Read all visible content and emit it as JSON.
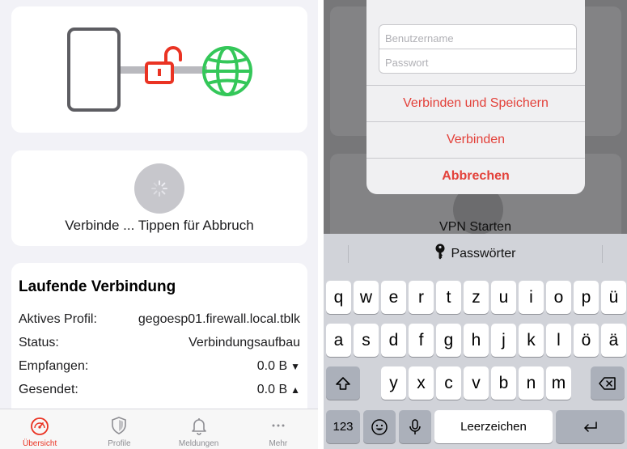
{
  "left": {
    "connect_status": "Verbinde ... Tippen für Abbruch",
    "running": {
      "title": "Laufende Verbindung",
      "rows": [
        {
          "label": "Aktives Profil:",
          "value": "gegoesp01.firewall.local.tblk",
          "arrow": ""
        },
        {
          "label": "Status:",
          "value": "Verbindungsaufbau",
          "arrow": ""
        },
        {
          "label": "Empfangen:",
          "value": "0.0 B",
          "arrow": "▼"
        },
        {
          "label": "Gesendet:",
          "value": "0.0 B",
          "arrow": "▲"
        }
      ]
    },
    "tabs": [
      {
        "label": "Übersicht",
        "icon": "speedometer-icon",
        "active": true
      },
      {
        "label": "Profile",
        "icon": "shield-icon",
        "active": false
      },
      {
        "label": "Meldungen",
        "icon": "bell-icon",
        "active": false
      },
      {
        "label": "Mehr",
        "icon": "more-icon",
        "active": false
      }
    ],
    "colors": {
      "accent_red": "#ea3323",
      "globe_green": "#34c759",
      "device_gray": "#5d5d62"
    }
  },
  "right": {
    "dialog": {
      "username_placeholder": "Benutzername",
      "password_placeholder": "Passwort",
      "btn_connect_save": "Verbinden und Speichern",
      "btn_connect": "Verbinden",
      "btn_cancel": "Abbrechen"
    },
    "background_label": "VPN Starten",
    "keyboard": {
      "suggestion": "Passwörter",
      "row1": [
        "q",
        "w",
        "e",
        "r",
        "t",
        "z",
        "u",
        "i",
        "o",
        "p",
        "ü"
      ],
      "row2": [
        "a",
        "s",
        "d",
        "f",
        "g",
        "h",
        "j",
        "k",
        "l",
        "ö",
        "ä"
      ],
      "row3": [
        "y",
        "x",
        "c",
        "v",
        "b",
        "n",
        "m"
      ],
      "numbers_key": "123",
      "space_key": "Leerzeichen"
    }
  }
}
